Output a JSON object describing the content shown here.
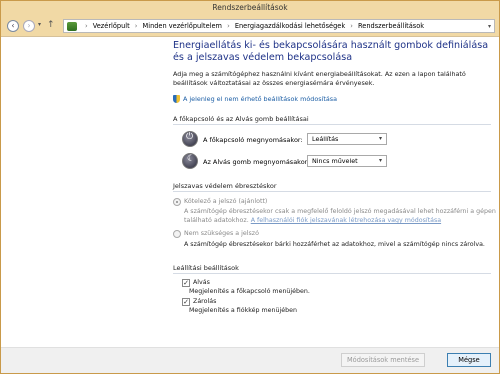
{
  "window": {
    "title": "Rendszerbeállítások"
  },
  "address": {
    "crumbs": [
      "Vezérlőpult",
      "Minden vezérlőpultelem",
      "Energiagazdálkodási lehetőségek",
      "Rendszerbeállítások"
    ],
    "separator": "›"
  },
  "nav": {
    "back": "‹",
    "forward": "›",
    "recent": "▾",
    "up": "↑",
    "dropdown": "▾"
  },
  "page": {
    "heading": "Energiaellátás ki- és bekapcsolására használt gombok definiálása és a jelszavas védelem bekapcsolása",
    "intro": "Adja meg a számítógéphez használni kívánt energiabeállításokat. Az ezen a lapon található beállítások változtatásai az összes energiasémára érvényesek.",
    "unavailable_link": "A jelenleg el nem érhető beállítások módosítása"
  },
  "buttons_section": {
    "title": "A főkapcsoló és az Alvás gomb beállításai",
    "power_label": "A főkapcsoló megnyomásakor:",
    "power_value": "Leállítás",
    "sleep_label": "Az Alvás gomb megnyomásakor:",
    "sleep_value": "Nincs művelet"
  },
  "password_section": {
    "title": "Jelszavas védelem ébresztéskor",
    "required_label": "Kötelező a jelszó (ajánlott)",
    "required_desc_1": "A számítógép ébresztésekor csak a megfelelő feloldó jelszó megadásával lehet hozzáférni a gépen",
    "required_desc_2": "található adatokhoz.",
    "required_link": "A felhasználói fiók jelszavának létrehozása vagy módosítása",
    "not_required_label": "Nem szükséges a jelszó",
    "not_required_desc": "A számítógép ébresztésekor bárki hozzáférhet az adatokhoz, mivel a számítógép nincs zárolva."
  },
  "shutdown_section": {
    "title": "Leállítási beállítások",
    "sleep_label": "Alvás",
    "sleep_desc": "Megjelenítés a főkapcsoló menüjében.",
    "lock_label": "Zárolás",
    "lock_desc": "Megjelenítés a fiókkép menüjében",
    "checkmark": "✓"
  },
  "footer": {
    "save": "Módosítások mentése",
    "cancel": "Mégse"
  },
  "colors": {
    "accent": "#1e3287",
    "link": "#1c5ea5",
    "titlebar": "#f1d9a5"
  }
}
